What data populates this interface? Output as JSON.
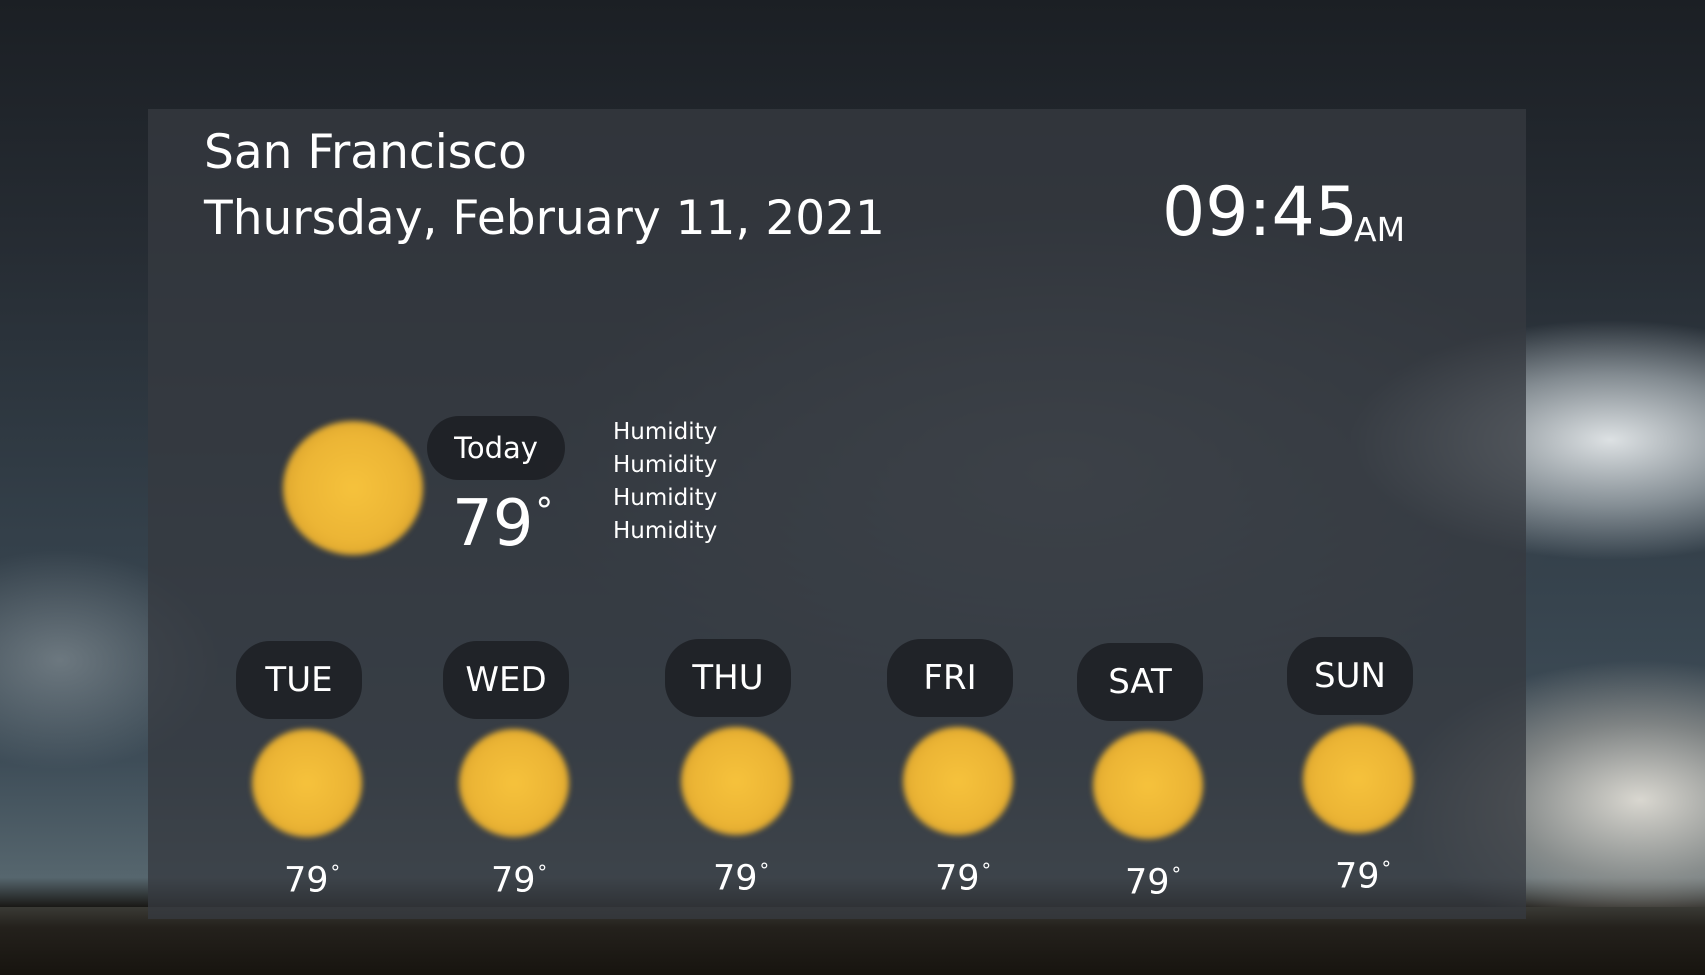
{
  "location": {
    "city": "San Francisco",
    "date": "Thursday, February 11, 2021"
  },
  "clock": {
    "time": "09:45",
    "period": "AM"
  },
  "today": {
    "label": "Today",
    "temp": "79",
    "degree_symbol": "°",
    "icon": "sun-icon",
    "details": [
      "Humidity",
      "Humidity",
      "Humidity",
      "Humidity"
    ]
  },
  "forecast": [
    {
      "day": "TUE",
      "temp": "79",
      "degree_symbol": "°",
      "icon": "sun-icon"
    },
    {
      "day": "WED",
      "temp": "79",
      "degree_symbol": "°",
      "icon": "sun-icon"
    },
    {
      "day": "THU",
      "temp": "79",
      "degree_symbol": "°",
      "icon": "sun-icon"
    },
    {
      "day": "FRI",
      "temp": "79",
      "degree_symbol": "°",
      "icon": "sun-icon"
    },
    {
      "day": "SAT",
      "temp": "79",
      "degree_symbol": "°",
      "icon": "sun-icon"
    },
    {
      "day": "SUN",
      "temp": "79",
      "degree_symbol": "°",
      "icon": "sun-icon"
    }
  ],
  "colors": {
    "sun": "#f0bb38",
    "pill_bg": "#1c1f23",
    "panel_bg": "#363a40"
  }
}
